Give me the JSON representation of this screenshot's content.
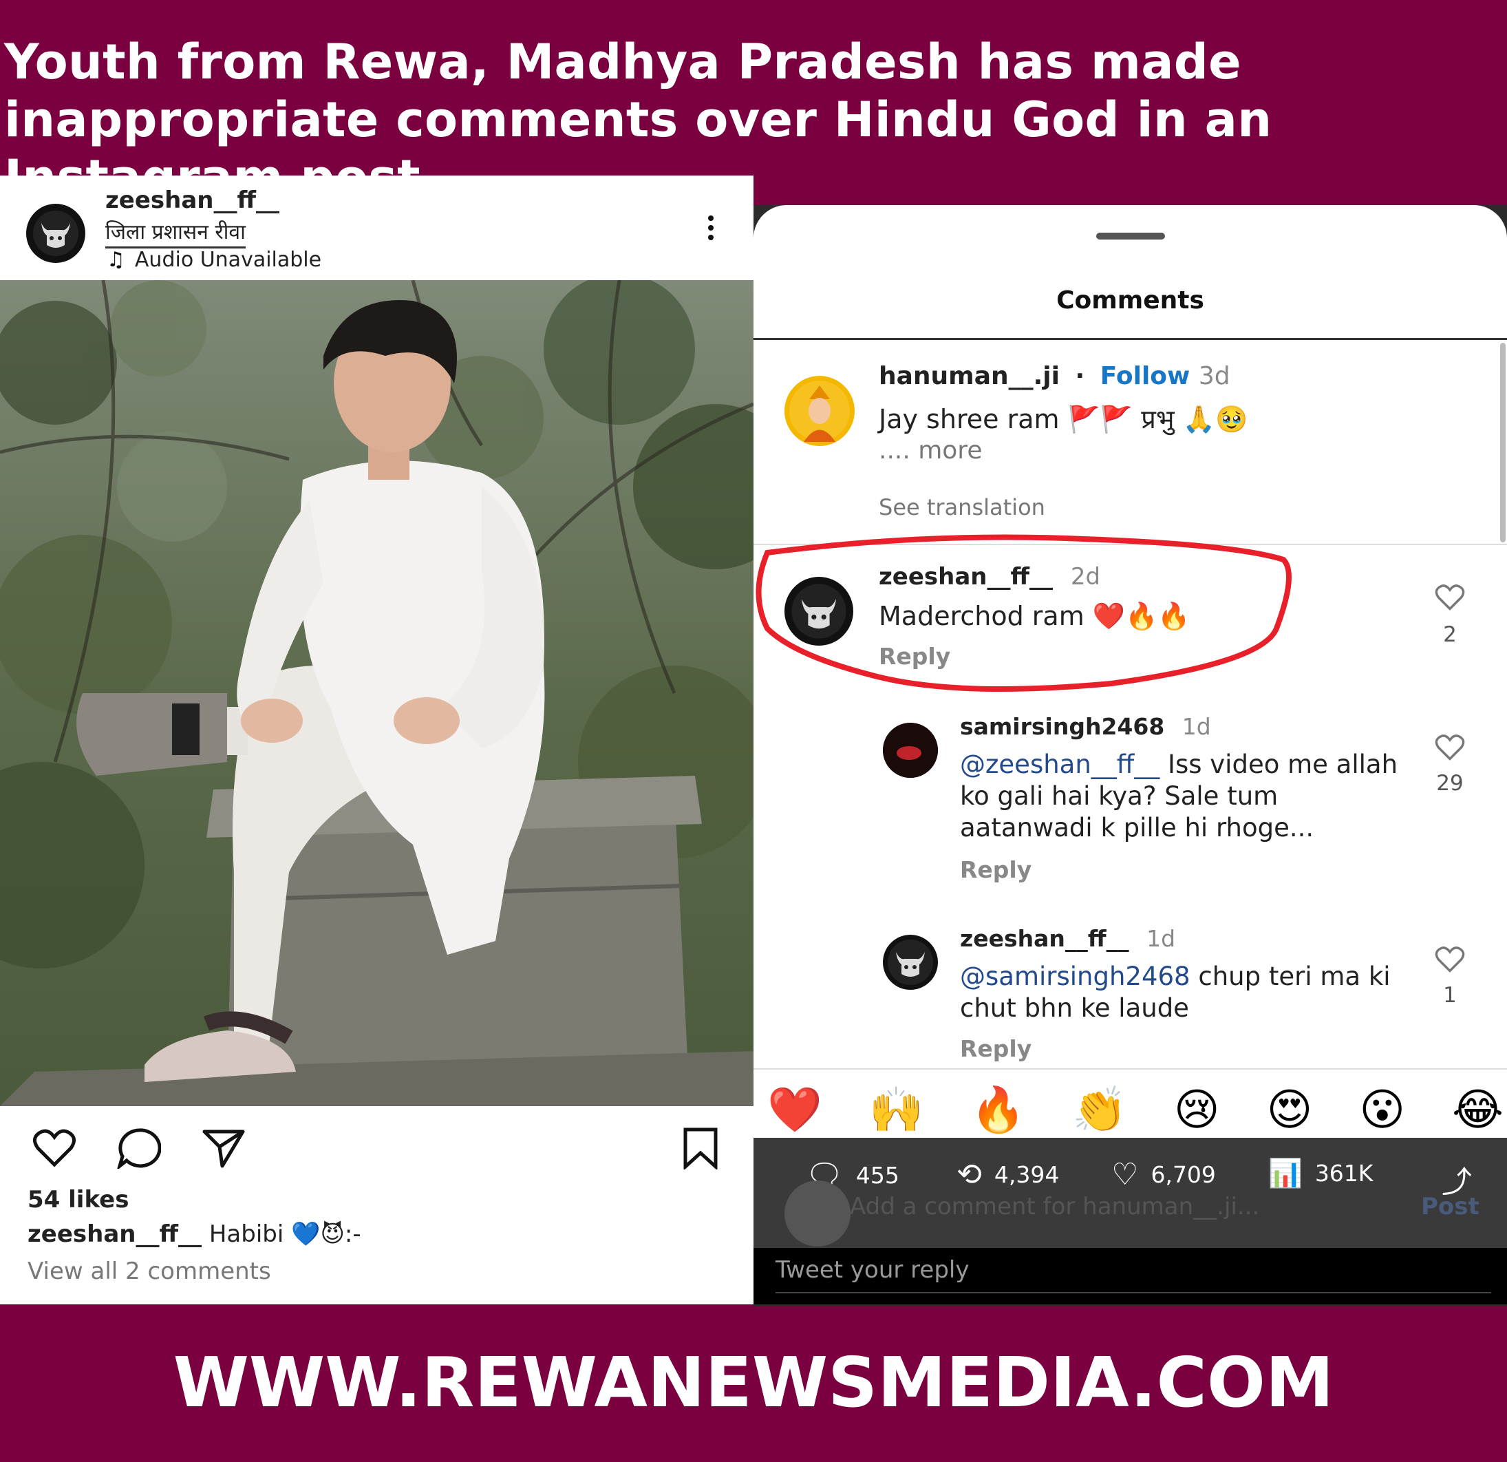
{
  "headline": "Youth from Rewa, Madhya Pradesh has made inappropriate comments over Hindu God in an Instagram post",
  "footer_url": "WWW.REWANEWSMEDIA.COM",
  "post": {
    "username": "zeeshan__ff__",
    "location": "जिला प्रशासन रीवा",
    "audio": "Audio Unavailable",
    "likes": "54 likes",
    "caption_user": "zeeshan__ff__",
    "caption_text": "Habibi 💙😈:-",
    "view_comments": "View all 2 comments"
  },
  "comments_sheet": {
    "title": "Comments",
    "items": [
      {
        "user": "hanuman__.ji",
        "follow": "Follow",
        "time": "3d",
        "text": "Jay shree ram 🚩🚩 प्रभु 🙏🥹",
        "more": ".... more",
        "see_translation": "See translation"
      },
      {
        "user": "zeeshan__ff__",
        "time": "2d",
        "text": "Maderchod ram ❤️🔥🔥",
        "reply": "Reply",
        "likes": "2"
      },
      {
        "user": "samirsingh2468",
        "time": "1d",
        "mention": "@zeeshan__ff__",
        "text": " Iss video me allah ko gali hai kya? Sale tum aatanwadi k pille hi rhoge...",
        "reply": "Reply",
        "likes": "29"
      },
      {
        "user": "zeeshan__ff__",
        "time": "1d",
        "mention": "@samirsingh2468",
        "text": "  chup teri ma ki chut bhn ke laude",
        "reply": "Reply",
        "likes": "1"
      }
    ],
    "emojis": [
      "❤️",
      "🙌",
      "🔥",
      "👏",
      "😢",
      "😍",
      "😮",
      "😂"
    ],
    "add_comment_placeholder": "Add a comment for hanuman__.ji...",
    "post_button": "Post"
  },
  "tweet_stats": {
    "replies": "455",
    "retweets": "4,394",
    "likes": "6,709",
    "views": "361K"
  },
  "tweet_reply_placeholder": "Tweet your reply",
  "colors": {
    "banner": "#7a0040",
    "follow_blue": "#1877c5",
    "mention_blue": "#234a8c",
    "highlight_red": "#e8202a"
  }
}
